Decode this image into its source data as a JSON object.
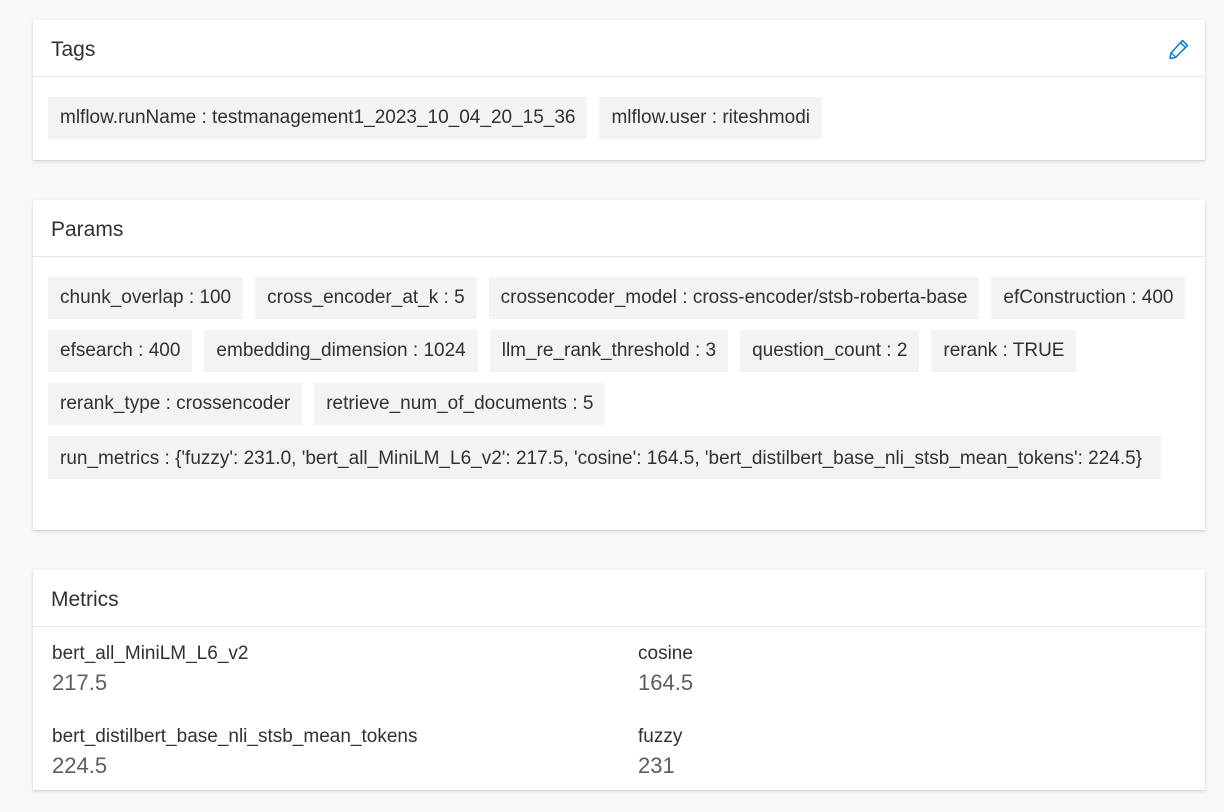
{
  "tags": {
    "title": "Tags",
    "edit_icon": "pencil-icon",
    "items": [
      "mlflow.runName : testmanagement1_2023_10_04_20_15_36",
      "mlflow.user : riteshmodi"
    ]
  },
  "params": {
    "title": "Params",
    "items": [
      "chunk_overlap : 100",
      "cross_encoder_at_k : 5",
      "crossencoder_model : cross-encoder/stsb-roberta-base",
      "efConstruction : 400",
      "efsearch : 400",
      "embedding_dimension : 1024",
      "llm_re_rank_threshold : 3",
      "question_count : 2",
      "rerank : TRUE",
      "rerank_type : crossencoder",
      "retrieve_num_of_documents : 5",
      "run_metrics : {'fuzzy': 231.0, 'bert_all_MiniLM_L6_v2': 217.5, 'cosine': 164.5, 'bert_distilbert_base_nli_stsb_mean_tokens': 224.5}"
    ]
  },
  "metrics": {
    "title": "Metrics",
    "items": [
      {
        "name": "bert_all_MiniLM_L6_v2",
        "value": "217.5"
      },
      {
        "name": "cosine",
        "value": "164.5"
      },
      {
        "name": "bert_distilbert_base_nli_stsb_mean_tokens",
        "value": "224.5"
      },
      {
        "name": "fuzzy",
        "value": "231"
      }
    ]
  },
  "colors": {
    "accent": "#0078d4",
    "chip_bg": "#f3f3f3",
    "page_bg": "#f8f8f8"
  }
}
